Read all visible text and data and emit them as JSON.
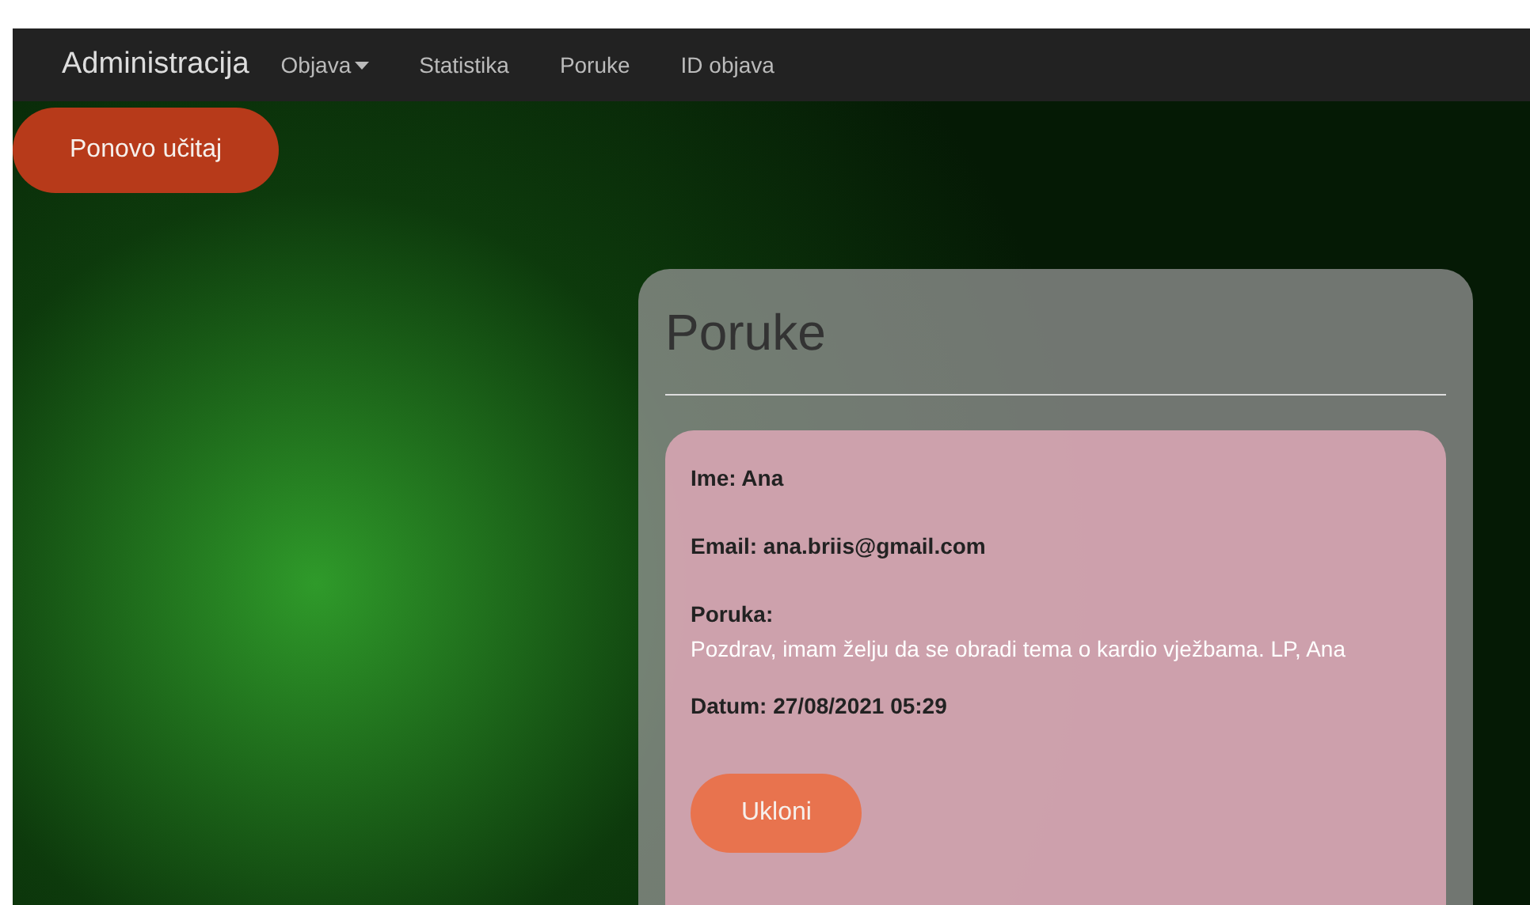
{
  "navbar": {
    "brand": "Administracija",
    "items": [
      {
        "label": "Objava",
        "kind": "dropdown"
      },
      {
        "label": "Statistika",
        "kind": "link"
      },
      {
        "label": "Poruke",
        "kind": "link"
      },
      {
        "label": "ID objava",
        "kind": "link"
      }
    ]
  },
  "reload_button": "Ponovo učitaj",
  "panel": {
    "title": "Poruke",
    "messages": [
      {
        "name": "Ime: Ana",
        "email": "Email: ana.briis@gmail.com",
        "message_label": "Poruka:",
        "message": "Pozdrav, imam želju da se obradi tema o kardio vježbama. LP, Ana",
        "date": "Datum: 27/08/2021 05:29",
        "remove_button": "Ukloni"
      }
    ]
  }
}
